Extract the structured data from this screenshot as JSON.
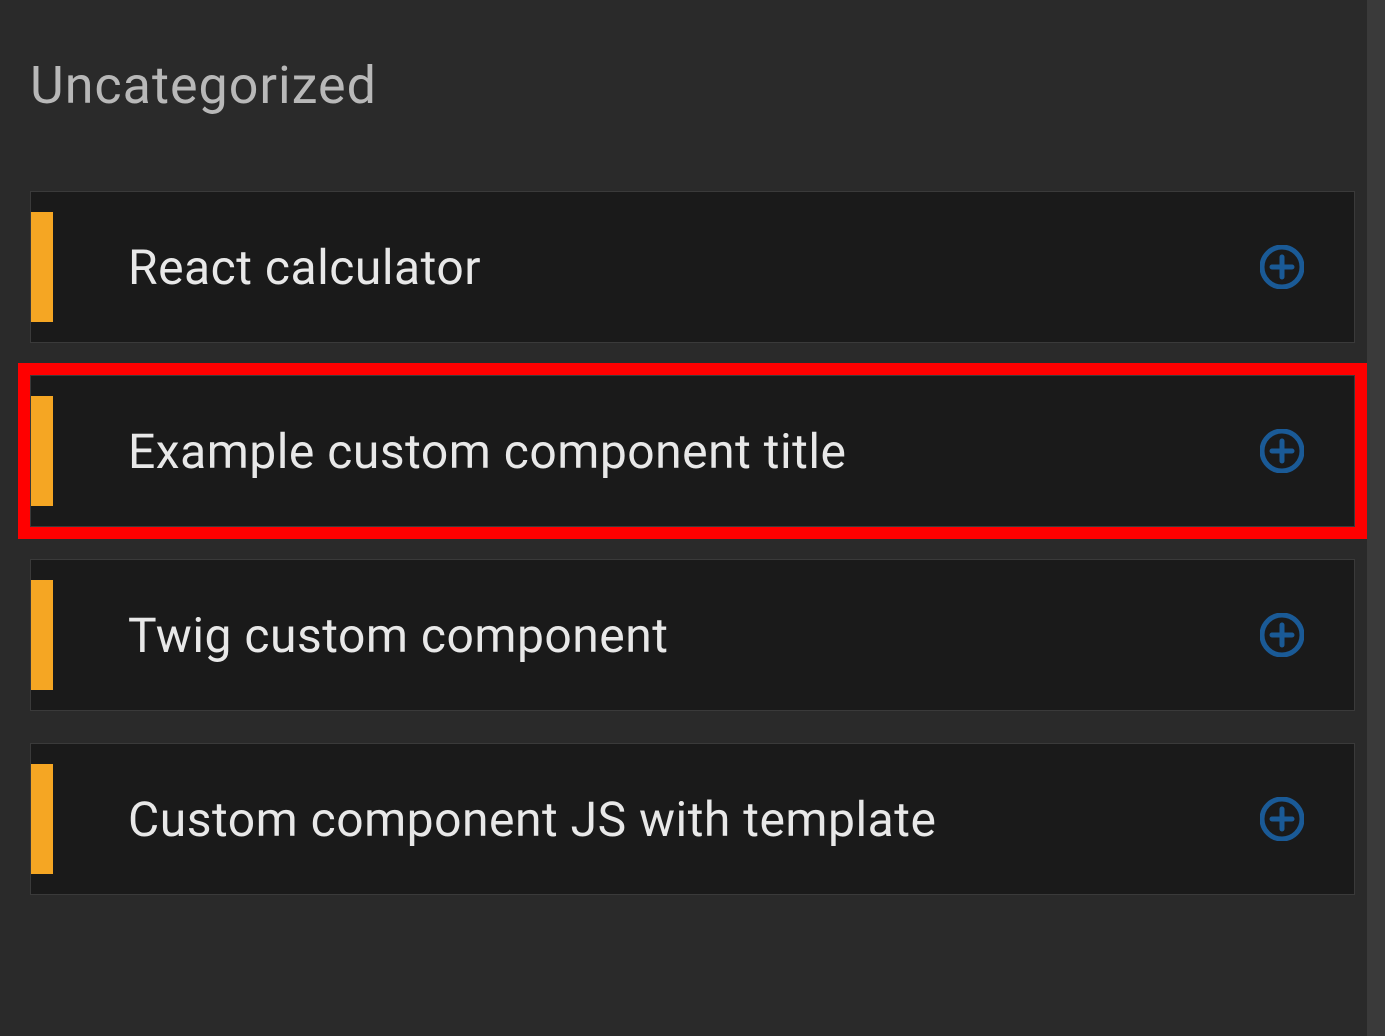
{
  "section": {
    "title": "Uncategorized"
  },
  "items": [
    {
      "label": "React calculator",
      "highlighted": false
    },
    {
      "label": "Example custom component title",
      "highlighted": true
    },
    {
      "label": "Twig custom component",
      "highlighted": false
    },
    {
      "label": "Custom component JS with template",
      "highlighted": false
    }
  ],
  "colors": {
    "accent": "#f5a623",
    "highlight": "#ff0000",
    "background": "#2a2a2a",
    "itemBackground": "#1a1a1a",
    "addIcon": "#1a5a96"
  }
}
